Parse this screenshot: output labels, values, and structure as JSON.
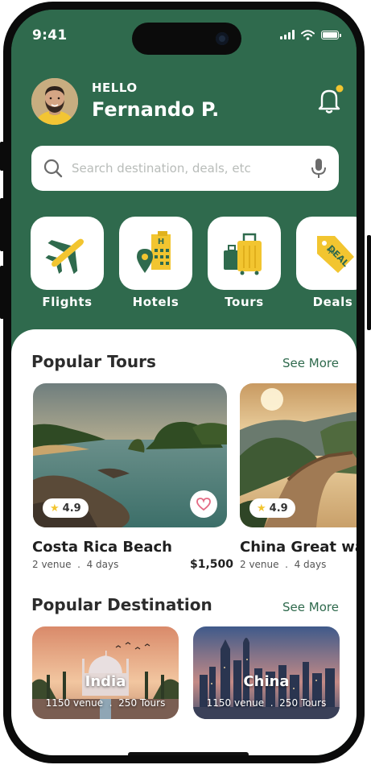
{
  "status_bar": {
    "time": "9:41"
  },
  "user": {
    "greeting": "HELLO",
    "name": "Fernando P."
  },
  "search": {
    "placeholder": "Search destination, deals, etc"
  },
  "categories": [
    {
      "label": "Flights",
      "icon": "airplane-icon"
    },
    {
      "label": "Hotels",
      "icon": "hotel-icon"
    },
    {
      "label": "Tours",
      "icon": "luggage-icon"
    },
    {
      "label": "Deals",
      "icon": "deal-tag-icon"
    }
  ],
  "popular_tours": {
    "title": "Popular Tours",
    "see_more": "See More",
    "items": [
      {
        "name": "Costa Rica Beach",
        "rating": "4.9",
        "venues": "2 venue",
        "days": "4 days",
        "price": "$1,500"
      },
      {
        "name": "China Great wall",
        "rating": "4.9",
        "venues": "2 venue",
        "days": "4 days"
      }
    ]
  },
  "popular_destination": {
    "title": "Popular Destination",
    "see_more": "See More",
    "items": [
      {
        "name": "India",
        "venues": "1150 venue",
        "tours": "250 Tours"
      },
      {
        "name": "China",
        "venues": "1150 venue",
        "tours": "250 Tours"
      }
    ]
  },
  "colors": {
    "brand": "#2f6a4d",
    "accent": "#f2c530",
    "heart": "#e46a84"
  }
}
